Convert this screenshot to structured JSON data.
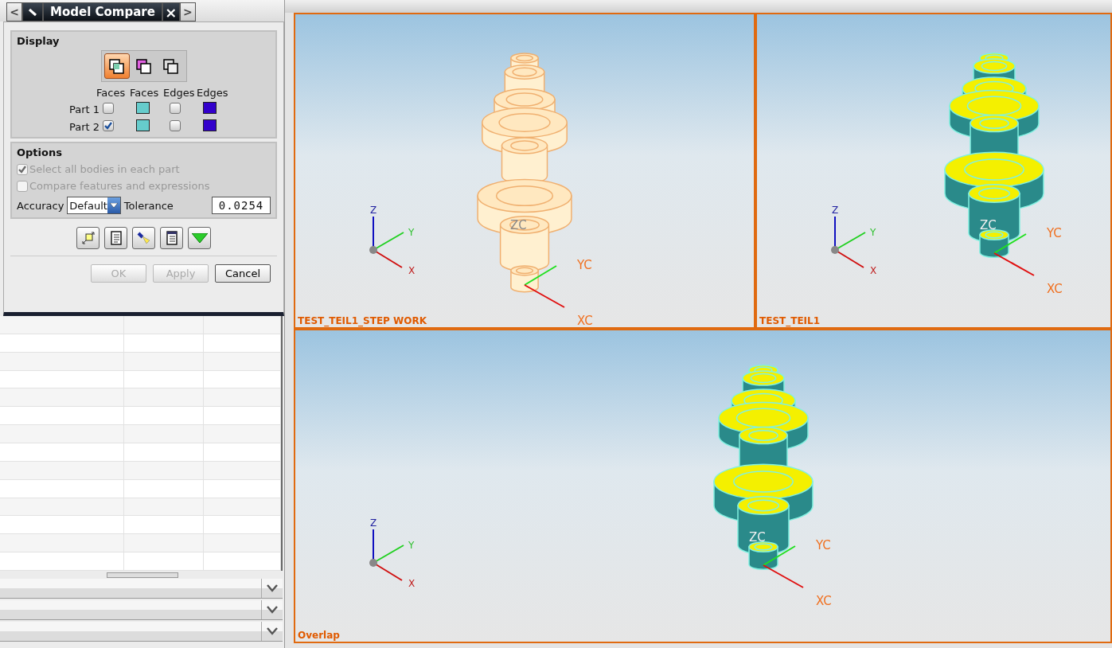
{
  "panel_tab": {
    "prev": "<",
    "title": "Model Compare",
    "close": "×",
    "next": ">"
  },
  "display": {
    "heading": "Display",
    "modes": [
      {
        "kind": "both",
        "selected": true
      },
      {
        "kind": "faces",
        "selected": false
      },
      {
        "kind": "edges",
        "selected": false
      }
    ],
    "column_headers": [
      "Faces",
      "Faces",
      "Edges",
      "Edges"
    ],
    "parts": [
      {
        "label": "Part 1",
        "faces": {
          "checked": false,
          "color": "#66cccc"
        },
        "edges": {
          "checked": false,
          "color": "#3300cc"
        }
      },
      {
        "label": "Part 2",
        "faces": {
          "checked": true,
          "color": "#66cccc"
        },
        "edges": {
          "checked": false,
          "color": "#3300cc"
        }
      }
    ]
  },
  "options": {
    "heading": "Options",
    "checkboxes": [
      {
        "label": "Select all bodies in each part",
        "checked": true,
        "disabled": true
      },
      {
        "label": "Compare features and expressions",
        "checked": false,
        "disabled": true
      }
    ],
    "accuracy_label": "Accuracy",
    "accuracy_value": "Default",
    "tolerance_label": "Tolerance",
    "tolerance_value": "0.0254"
  },
  "buttons": [
    {
      "label": "OK",
      "disabled": true
    },
    {
      "label": "Apply",
      "disabled": true
    },
    {
      "label": "Cancel",
      "disabled": false
    }
  ],
  "viewports": [
    {
      "label": "TEST_TEIL1_STEP WORK",
      "kind": "wire",
      "axes": [
        "Z",
        "Y",
        "X"
      ],
      "work_axes": [
        "ZC",
        "YC",
        "XC"
      ]
    },
    {
      "label": "TEST_TEIL1",
      "kind": "shaded",
      "axes": [
        "Z",
        "Y",
        "X"
      ],
      "work_axes": [
        "ZC",
        "YC",
        "XC"
      ]
    },
    {
      "label": "Overlap",
      "kind": "shaded",
      "axes": [
        "Z",
        "Y",
        "X"
      ],
      "work_axes": [
        "ZC",
        "YC",
        "XC"
      ]
    }
  ]
}
